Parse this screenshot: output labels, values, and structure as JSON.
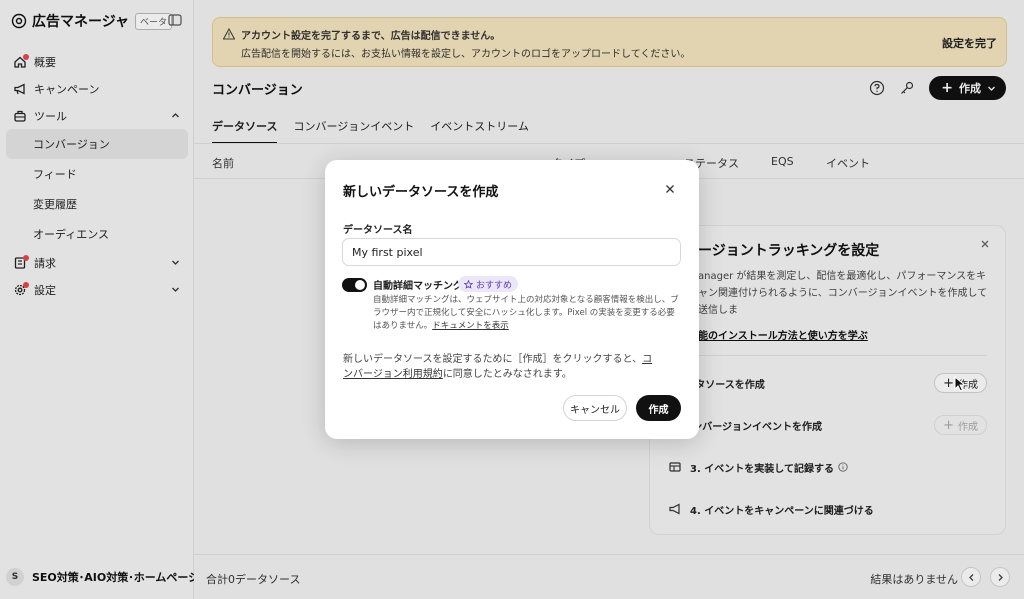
{
  "sidebar": {
    "brand_title": "広告マネージャ",
    "beta_badge": "ベータ",
    "items": [
      {
        "label": "概要",
        "icon": "home-icon"
      },
      {
        "label": "キャンペーン",
        "icon": "megaphone-icon"
      },
      {
        "label": "ツール",
        "icon": "toolbox-icon"
      },
      {
        "label": "コンバージョン"
      },
      {
        "label": "フィード"
      },
      {
        "label": "変更履歴"
      },
      {
        "label": "オーディエンス"
      },
      {
        "label": "請求",
        "icon": "billing-icon"
      },
      {
        "label": "設定",
        "icon": "gear-icon"
      }
    ],
    "account_initial": "S",
    "account_name": "SEO対策･AIO対策･ホームページ..."
  },
  "alert": {
    "line1": "アカウント設定を完了するまで、広告は配信できません。",
    "line2": "広告配信を開始するには、お支払い情報を設定し、アカウントのロゴをアップロードしてください。",
    "action": "設定を完了"
  },
  "header": {
    "title": "コンバージョン",
    "create_label": "作成"
  },
  "tabs": [
    "データソース",
    "コンバージョンイベント",
    "イベントストリーム"
  ],
  "table": {
    "columns": [
      "名前",
      "タイプ",
      "ステータス",
      "EQS",
      "イベント"
    ]
  },
  "footer": {
    "total": "合計0データソース",
    "no_results": "結果はありません"
  },
  "setup_card": {
    "title": "ージョントラッキングを設定",
    "desc": "anager が結果を測定し、配信を最適化し、パフォーマンスをキャン関連付けられるように、コンバージョンイベントを作成して送信しま",
    "link": "能のインストール方法と使い方を学ぶ",
    "steps": [
      {
        "label": ". データソースを作成",
        "button": "作成"
      },
      {
        "label": "2. コンバージョンイベントを作成",
        "button": "作成"
      },
      {
        "label": "3. イベントを実装して記録する"
      },
      {
        "label": "4. イベントをキャンペーンに関連づける"
      }
    ]
  },
  "modal": {
    "title": "新しいデータソースを作成",
    "field_label": "データソース名",
    "field_value": "My first pixel",
    "toggle_label": "自動詳細マッチング",
    "badge": "おすすめ",
    "toggle_desc": "自動詳細マッチングは、ウェブサイト上の対応対象となる顧客情報を検出し、ブラウザー内で正規化して安全にハッシュ化します。Pixel の実装を変更する必要はありません。",
    "toggle_link": "ドキュメントを表示",
    "consent_prefix": "新しいデータソースを設定するために［作成］をクリックすると、",
    "consent_link": "コンバージョン利用規約",
    "consent_suffix": "に同意したとみなされます。",
    "cancel": "キャンセル",
    "create": "作成"
  }
}
